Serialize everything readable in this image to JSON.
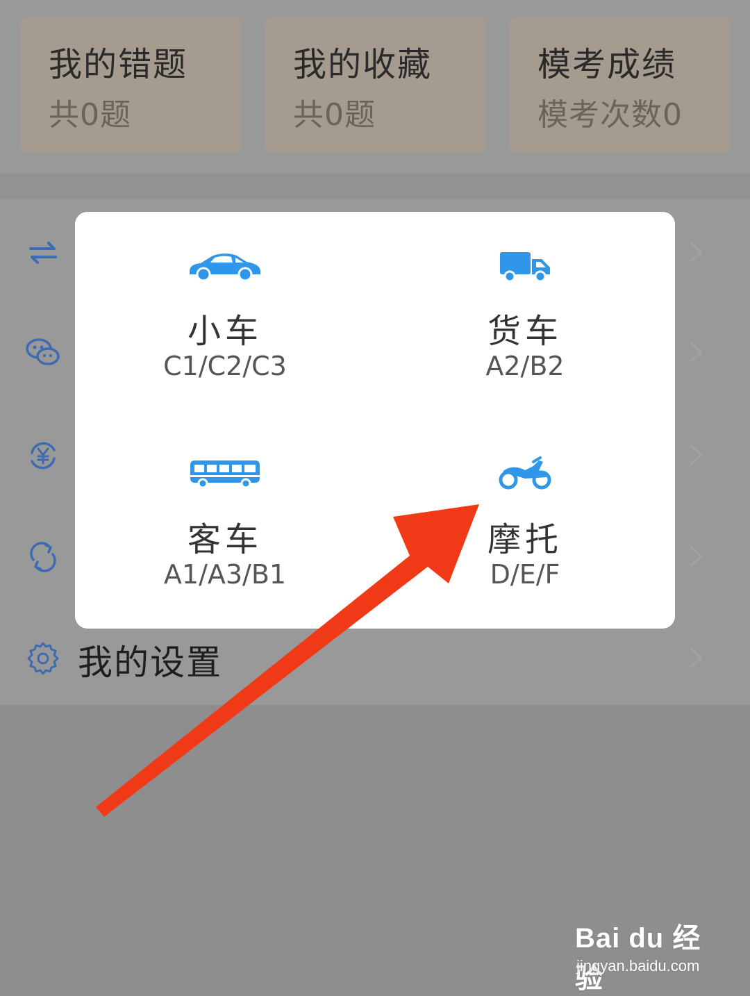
{
  "stats": [
    {
      "title": "我的错题",
      "sub": "共0题"
    },
    {
      "title": "我的收藏",
      "sub": "共0题"
    },
    {
      "title": "模考成绩",
      "sub": "模考次数0"
    }
  ],
  "menu": {
    "settings_label": "我的设置"
  },
  "vehicle_picker": {
    "options": [
      {
        "name": "小车",
        "code": "C1/C2/C3",
        "icon": "car-icon"
      },
      {
        "name": "货车",
        "code": "A2/B2",
        "icon": "truck-icon"
      },
      {
        "name": "客车",
        "code": "A1/A3/B1",
        "icon": "bus-icon"
      },
      {
        "name": "摩托",
        "code": "D/E/F",
        "icon": "motorcycle-icon"
      }
    ]
  },
  "colors": {
    "icon_blue": "#2f96ea",
    "menu_icon_blue": "#3d6ab0",
    "arrow_red": "#f03a17"
  },
  "watermark": {
    "brand": "Bai du 经验",
    "url": "jingyan.baidu.com"
  }
}
